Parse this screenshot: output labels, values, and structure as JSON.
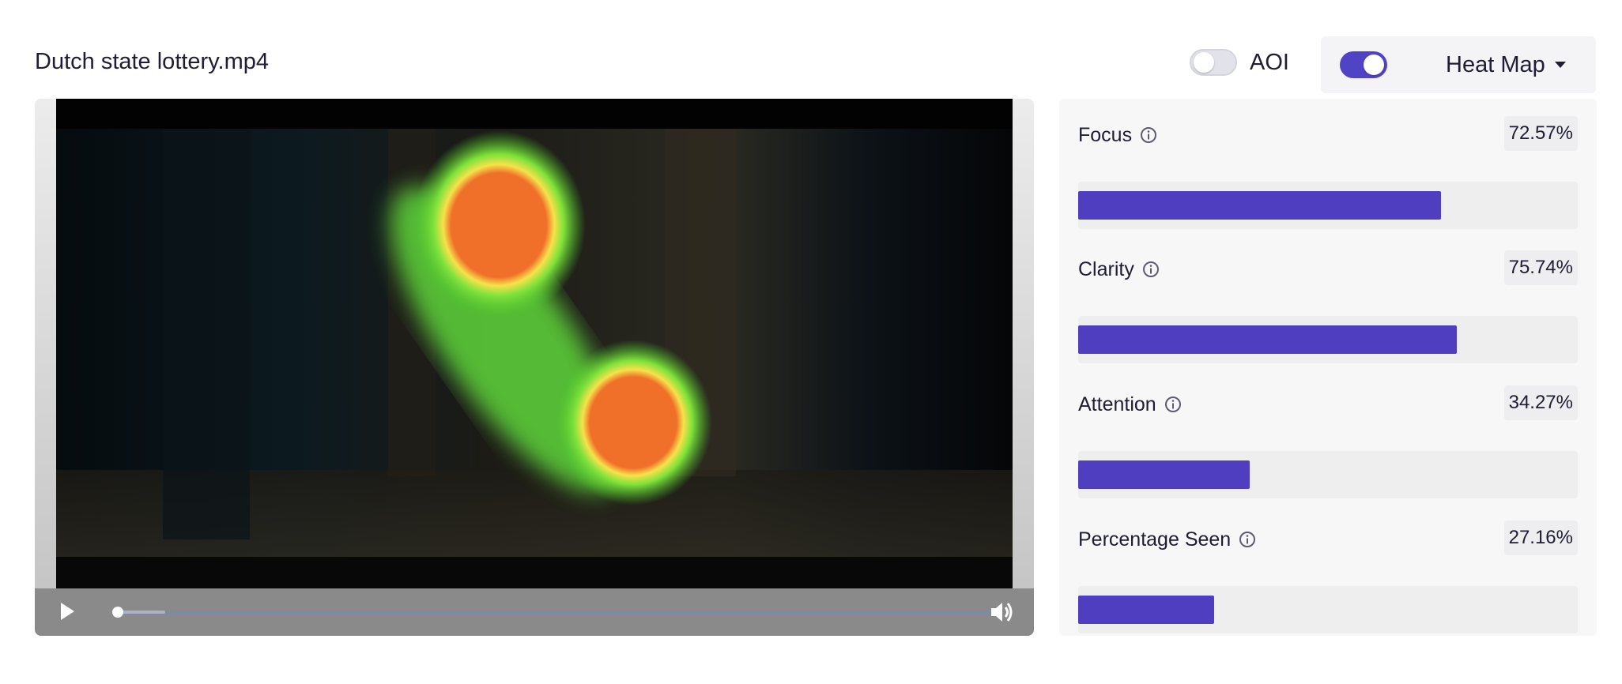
{
  "header": {
    "file_name": "Dutch state lottery.mp4",
    "aoi_label": "AOI",
    "aoi_enabled": false,
    "overlay_enabled": true,
    "view_mode": "Heat Map"
  },
  "player": {
    "progress_fraction": 0.0,
    "buffered_fraction": 0.06,
    "play_icon": "play-icon",
    "volume_icon": "volume-icon"
  },
  "metrics": [
    {
      "label": "Focus",
      "value_text": "72.57%",
      "value": 72.57
    },
    {
      "label": "Clarity",
      "value_text": "75.74%",
      "value": 75.74
    },
    {
      "label": "Attention",
      "value_text": "34.27%",
      "value": 34.27
    },
    {
      "label": "Percentage Seen",
      "value_text": "27.16%",
      "value": 27.16
    }
  ],
  "colors": {
    "accent": "#4f3fc0",
    "heat_hot": "#f0702a",
    "heat_warm": "#f6e24a",
    "heat_cool": "#5fd63a"
  }
}
